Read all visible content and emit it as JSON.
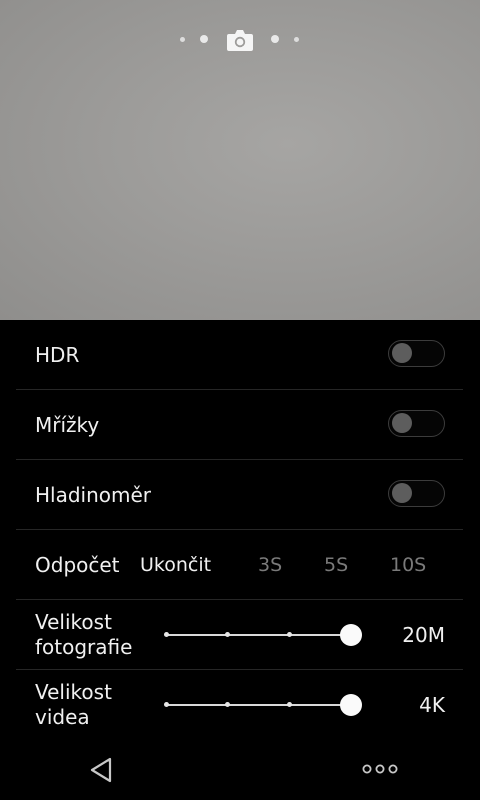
{
  "viewfinder": {
    "mode_indicator": {
      "icon": "camera-icon",
      "dots": 4
    }
  },
  "settings": {
    "hdr": {
      "label": "HDR",
      "enabled": false
    },
    "grid": {
      "label": "Mřížky",
      "enabled": false
    },
    "level": {
      "label": "Hladinoměr",
      "enabled": false
    },
    "timer": {
      "label": "Odpočet",
      "options": [
        "Ukončit",
        "3S",
        "5S",
        "10S"
      ],
      "selected": "Ukončit"
    },
    "photo_size": {
      "label_line1": "Velikost",
      "label_line2": "fotografie",
      "value": "20M",
      "steps": 4,
      "selected_step": 4
    },
    "video_size": {
      "label_line1": "Velikost",
      "label_line2": "videa",
      "value": "4K",
      "steps": 4,
      "selected_step": 4
    }
  },
  "navbar": {
    "back_icon": "back-triangle-icon",
    "more_icon": "more-dots-icon"
  },
  "colors": {
    "background": "#000000",
    "text": "#f0f0f0",
    "inactive_text": "#7a7a7a",
    "divider": "#262626"
  }
}
